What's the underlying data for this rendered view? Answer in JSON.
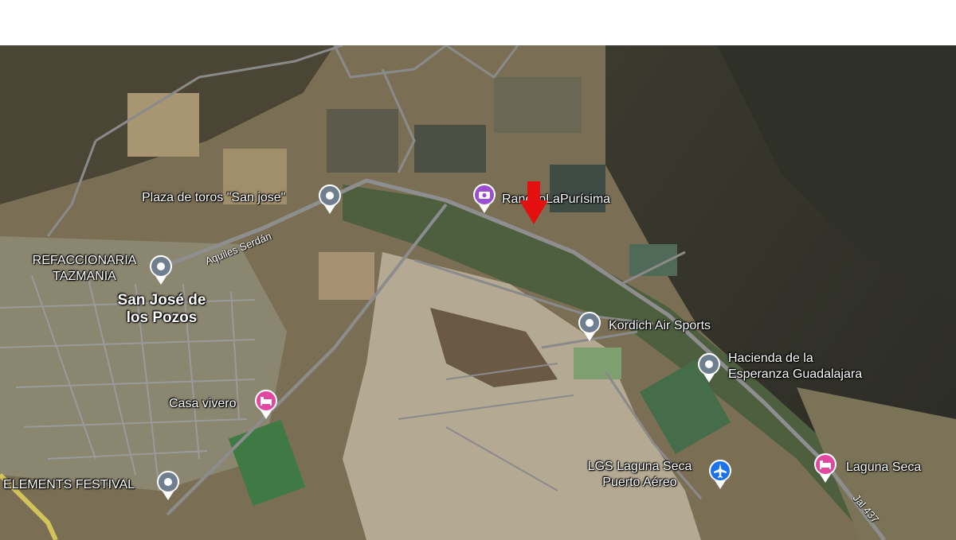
{
  "places": {
    "plaza_toros": "Plaza de toros \"San jose\"",
    "rancho": "RanchoLaPurísima",
    "refaccionaria": "REFACCIONARIA\nTAZMANIA",
    "town": "San José de\nlos Pozos",
    "kordich": "Kordich Air Sports",
    "hacienda": "Hacienda de la\nEsperanza Guadalajara",
    "casa_vivero": "Casa vivero",
    "elements": "ELEMENTS FESTIVAL",
    "laguna_airport": "LGS Laguna Seca\nPuerto Aéreo",
    "laguna_seca": "Laguna Seca"
  },
  "roads": {
    "aquiles": "Aquiles Serdán",
    "jal": "Jal 437"
  },
  "icons": {
    "place_pin": "map-pin-icon",
    "hotel": "bed-icon",
    "airport": "airplane-icon",
    "marker": "red-arrow-icon",
    "rancho": "camera-icon"
  },
  "colors": {
    "pin_gray": "#6f7f8f",
    "pin_pink": "#e2489f",
    "pin_blue": "#1a73e8",
    "pin_purple": "#9b4fd1",
    "marker_red": "#e3100f"
  }
}
